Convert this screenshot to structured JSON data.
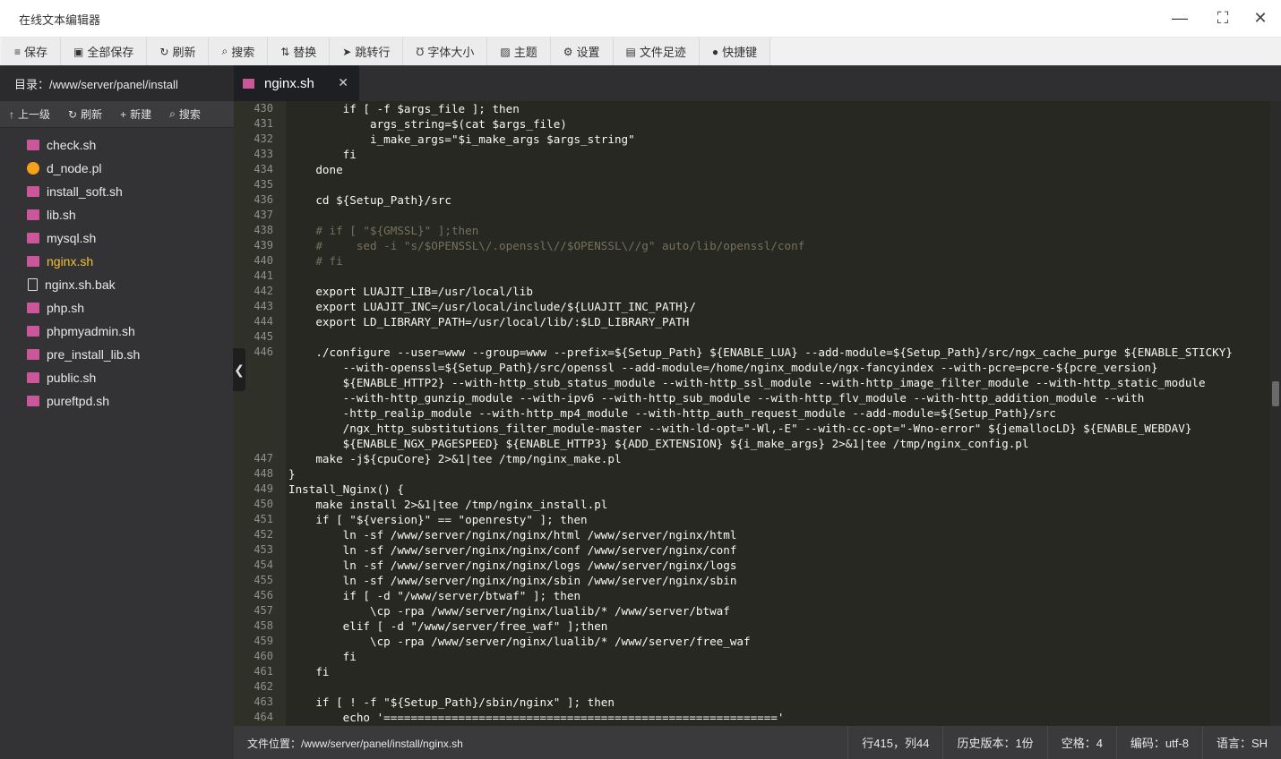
{
  "window": {
    "title": "在线文本编辑器"
  },
  "toolbar": {
    "items": [
      {
        "icon": "save-icon",
        "glyph": "≡",
        "label": "保存"
      },
      {
        "icon": "save-all-icon",
        "glyph": "▣",
        "label": "全部保存"
      },
      {
        "icon": "refresh-icon",
        "glyph": "↻",
        "label": "刷新"
      },
      {
        "icon": "search-icon",
        "glyph": "⌕",
        "label": "搜索"
      },
      {
        "icon": "replace-icon",
        "glyph": "⇅",
        "label": "替换"
      },
      {
        "icon": "goto-line-icon",
        "glyph": "➤",
        "label": "跳转行"
      },
      {
        "icon": "font-size-icon",
        "glyph": "Ʊ",
        "label": "字体大小"
      },
      {
        "icon": "theme-icon",
        "glyph": "▨",
        "label": "主题"
      },
      {
        "icon": "settings-icon",
        "glyph": "⚙",
        "label": "设置"
      },
      {
        "icon": "history-icon",
        "glyph": "▤",
        "label": "文件足迹"
      },
      {
        "icon": "shortcut-icon",
        "glyph": "●",
        "label": "快捷键"
      }
    ]
  },
  "sidebar": {
    "path": "目录：/www/server/panel/install",
    "actions": [
      {
        "glyph": "↑",
        "label": "上一级"
      },
      {
        "glyph": "↻",
        "label": "刷新"
      },
      {
        "glyph": "+",
        "label": "新建"
      },
      {
        "glyph": "⌕",
        "label": "搜索"
      }
    ],
    "files": [
      {
        "name": "check.sh",
        "type": "sh"
      },
      {
        "name": "d_node.pl",
        "type": "php"
      },
      {
        "name": "install_soft.sh",
        "type": "sh"
      },
      {
        "name": "lib.sh",
        "type": "sh"
      },
      {
        "name": "mysql.sh",
        "type": "sh"
      },
      {
        "name": "nginx.sh",
        "type": "sh",
        "active": true
      },
      {
        "name": "nginx.sh.bak",
        "type": "doc"
      },
      {
        "name": "php.sh",
        "type": "sh"
      },
      {
        "name": "phpmyadmin.sh",
        "type": "sh"
      },
      {
        "name": "pre_install_lib.sh",
        "type": "sh"
      },
      {
        "name": "public.sh",
        "type": "sh"
      },
      {
        "name": "pureftpd.sh",
        "type": "sh"
      }
    ]
  },
  "tab": {
    "label": "nginx.sh",
    "close": "✕"
  },
  "editor": {
    "lines": [
      {
        "n": "430",
        "t": "        if [ -f $args_file ]; then"
      },
      {
        "n": "431",
        "t": "            args_string=$(cat $args_file)"
      },
      {
        "n": "432",
        "t": "            i_make_args=\"$i_make_args $args_string\""
      },
      {
        "n": "433",
        "t": "        fi"
      },
      {
        "n": "434",
        "t": "    done"
      },
      {
        "n": "435",
        "t": ""
      },
      {
        "n": "436",
        "t": "    cd ${Setup_Path}/src"
      },
      {
        "n": "437",
        "t": ""
      },
      {
        "n": "438",
        "t": "    # if [ \"${GMSSL}\" ];then"
      },
      {
        "n": "439",
        "t": "    #     sed -i \"s/$OPENSSL\\/.openssl\\//$OPENSSL\\//g\" auto/lib/openssl/conf"
      },
      {
        "n": "440",
        "t": "    # fi"
      },
      {
        "n": "441",
        "t": ""
      },
      {
        "n": "442",
        "t": "    export LUAJIT_LIB=/usr/local/lib"
      },
      {
        "n": "443",
        "t": "    export LUAJIT_INC=/usr/local/include/${LUAJIT_INC_PATH}/"
      },
      {
        "n": "444",
        "t": "    export LD_LIBRARY_PATH=/usr/local/lib/:$LD_LIBRARY_PATH"
      },
      {
        "n": "445",
        "t": ""
      },
      {
        "n": "446",
        "t": "    ./configure --user=www --group=www --prefix=${Setup_Path} ${ENABLE_LUA} --add-module=${Setup_Path}/src/ngx_cache_purge ${ENABLE_STICKY}"
      },
      {
        "n": "",
        "t": "        --with-openssl=${Setup_Path}/src/openssl --add-module=/home/nginx_module/ngx-fancyindex --with-pcre=pcre-${pcre_version}"
      },
      {
        "n": "",
        "t": "        ${ENABLE_HTTP2} --with-http_stub_status_module --with-http_ssl_module --with-http_image_filter_module --with-http_static_module"
      },
      {
        "n": "",
        "t": "        --with-http_gunzip_module --with-ipv6 --with-http_sub_module --with-http_flv_module --with-http_addition_module --with"
      },
      {
        "n": "",
        "t": "        -http_realip_module --with-http_mp4_module --with-http_auth_request_module --add-module=${Setup_Path}/src"
      },
      {
        "n": "",
        "t": "        /ngx_http_substitutions_filter_module-master --with-ld-opt=\"-Wl,-E\" --with-cc-opt=\"-Wno-error\" ${jemallocLD} ${ENABLE_WEBDAV}"
      },
      {
        "n": "",
        "t": "        ${ENABLE_NGX_PAGESPEED} ${ENABLE_HTTP3} ${ADD_EXTENSION} ${i_make_args} 2>&1|tee /tmp/nginx_config.pl"
      },
      {
        "n": "447",
        "t": "    make -j${cpuCore} 2>&1|tee /tmp/nginx_make.pl"
      },
      {
        "n": "448",
        "t": "}"
      },
      {
        "n": "449",
        "t": "Install_Nginx() {"
      },
      {
        "n": "450",
        "t": "    make install 2>&1|tee /tmp/nginx_install.pl"
      },
      {
        "n": "451",
        "t": "    if [ \"${version}\" == \"openresty\" ]; then"
      },
      {
        "n": "452",
        "t": "        ln -sf /www/server/nginx/nginx/html /www/server/nginx/html"
      },
      {
        "n": "453",
        "t": "        ln -sf /www/server/nginx/nginx/conf /www/server/nginx/conf"
      },
      {
        "n": "454",
        "t": "        ln -sf /www/server/nginx/nginx/logs /www/server/nginx/logs"
      },
      {
        "n": "455",
        "t": "        ln -sf /www/server/nginx/nginx/sbin /www/server/nginx/sbin"
      },
      {
        "n": "456",
        "t": "        if [ -d \"/www/server/btwaf\" ]; then"
      },
      {
        "n": "457",
        "t": "            \\cp -rpa /www/server/nginx/lualib/* /www/server/btwaf"
      },
      {
        "n": "458",
        "t": "        elif [ -d \"/www/server/free_waf\" ];then"
      },
      {
        "n": "459",
        "t": "            \\cp -rpa /www/server/nginx/lualib/* /www/server/free_waf"
      },
      {
        "n": "460",
        "t": "        fi"
      },
      {
        "n": "461",
        "t": "    fi"
      },
      {
        "n": "462",
        "t": ""
      },
      {
        "n": "463",
        "t": "    if [ ! -f \"${Setup_Path}/sbin/nginx\" ]; then"
      },
      {
        "n": "464",
        "t": "        echo '=========================================================='"
      }
    ]
  },
  "status": {
    "file_location": "文件位置：/www/server/panel/install/nginx.sh",
    "cursor": "行415，列44",
    "history": "历史版本：1份",
    "indent": "空格：4",
    "encoding": "编码：utf-8",
    "language": "语言：SH"
  }
}
